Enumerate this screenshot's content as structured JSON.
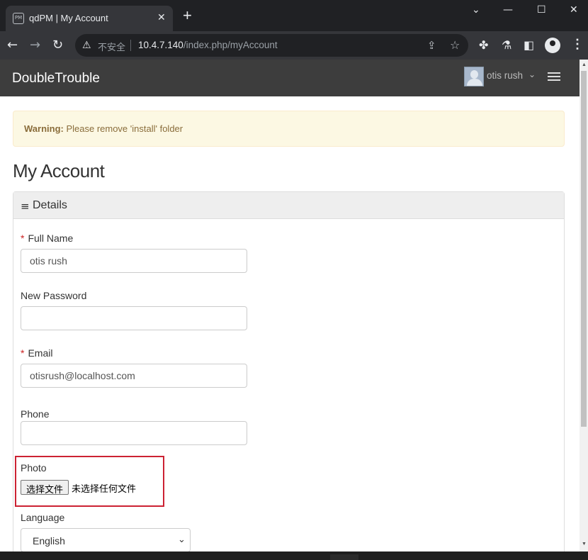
{
  "browser": {
    "tab_title": "qdPM | My Account",
    "tab_favicon_text": "PM",
    "tab_close_glyph": "✕",
    "new_tab_glyph": "+",
    "window_controls": [
      "⌄",
      "—",
      "☐",
      "✕"
    ],
    "nav_icons": [
      "back-icon",
      "forward-icon",
      "reload-icon"
    ],
    "security_warning": "不安全",
    "url_host": "10.4.7.140",
    "url_path": "/index.php/myAccount"
  },
  "app": {
    "brand": "DoubleTrouble",
    "user_name": "otis rush",
    "user_caret": "⌄"
  },
  "alert": {
    "strong": "Warning:",
    "text": " Please remove 'install' folder"
  },
  "page": {
    "title": "My Account"
  },
  "panel": {
    "menu_icon": "≡",
    "title": "Details"
  },
  "form": {
    "required_mark": "*",
    "full_name_label": "Full Name",
    "full_name_value": "otis rush",
    "new_password_label": "New Password",
    "new_password_value": "",
    "email_label": "Email",
    "email_value": "otisrush@localhost.com",
    "phone_label": "Phone",
    "phone_value": "",
    "photo_label": "Photo",
    "photo_button": "选择文件",
    "photo_status": "未选择任何文件",
    "language_label": "Language",
    "language_value": "English"
  },
  "colors": {
    "header_bg": "#3d3d3d",
    "alert_bg": "#fcf8e3",
    "alert_text": "#8a6d3b",
    "highlight_border": "#cc2233"
  }
}
